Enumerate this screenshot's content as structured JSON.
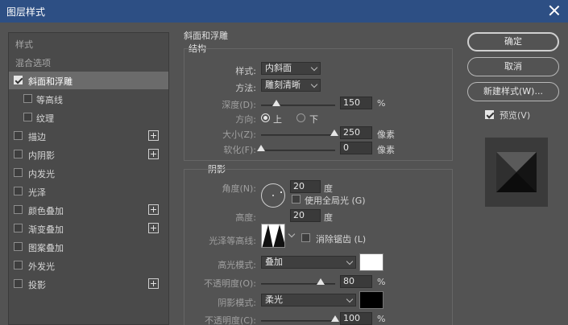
{
  "window": {
    "title": "图层样式"
  },
  "left_panel": {
    "items": [
      {
        "label": "样式",
        "checkbox": false,
        "checked": false,
        "selected": false,
        "plus": false,
        "indent": false,
        "dim": true
      },
      {
        "label": "混合选项",
        "checkbox": false,
        "checked": false,
        "selected": false,
        "plus": false,
        "indent": false,
        "dim": true
      },
      {
        "label": "斜面和浮雕",
        "checkbox": true,
        "checked": true,
        "selected": true,
        "plus": false,
        "indent": false,
        "dim": false
      },
      {
        "label": "等高线",
        "checkbox": true,
        "checked": false,
        "selected": false,
        "plus": false,
        "indent": true,
        "dim": false
      },
      {
        "label": "纹理",
        "checkbox": true,
        "checked": false,
        "selected": false,
        "plus": false,
        "indent": true,
        "dim": false
      },
      {
        "label": "描边",
        "checkbox": true,
        "checked": false,
        "selected": false,
        "plus": true,
        "indent": false,
        "dim": false
      },
      {
        "label": "内阴影",
        "checkbox": true,
        "checked": false,
        "selected": false,
        "plus": true,
        "indent": false,
        "dim": false
      },
      {
        "label": "内发光",
        "checkbox": true,
        "checked": false,
        "selected": false,
        "plus": false,
        "indent": false,
        "dim": false
      },
      {
        "label": "光泽",
        "checkbox": true,
        "checked": false,
        "selected": false,
        "plus": false,
        "indent": false,
        "dim": false
      },
      {
        "label": "颜色叠加",
        "checkbox": true,
        "checked": false,
        "selected": false,
        "plus": true,
        "indent": false,
        "dim": false
      },
      {
        "label": "渐变叠加",
        "checkbox": true,
        "checked": false,
        "selected": false,
        "plus": true,
        "indent": false,
        "dim": false
      },
      {
        "label": "图案叠加",
        "checkbox": true,
        "checked": false,
        "selected": false,
        "plus": false,
        "indent": false,
        "dim": false
      },
      {
        "label": "外发光",
        "checkbox": true,
        "checked": false,
        "selected": false,
        "plus": false,
        "indent": false,
        "dim": false
      },
      {
        "label": "投影",
        "checkbox": true,
        "checked": false,
        "selected": false,
        "plus": true,
        "indent": false,
        "dim": false
      }
    ]
  },
  "bevel": {
    "section_title": "斜面和浮雕",
    "structure_title": "结构",
    "style_label": "样式:",
    "style_value": "内斜面",
    "technique_label": "方法:",
    "technique_value": "雕刻清晰",
    "depth_label": "深度(D):",
    "depth_value": "150",
    "depth_unit": "%",
    "direction_label": "方向:",
    "direction_up": "上",
    "direction_down": "下",
    "size_label": "大小(Z):",
    "size_value": "250",
    "size_unit": "像素",
    "soften_label": "软化(F):",
    "soften_value": "0",
    "soften_unit": "像素"
  },
  "shading": {
    "section_title": "阴影",
    "angle_label": "角度(N):",
    "angle_value": "20",
    "angle_unit": "度",
    "global_light_label": "使用全局光 (G)",
    "altitude_label": "高度:",
    "altitude_value": "20",
    "altitude_unit": "度",
    "gloss_contour_label": "光泽等高线:",
    "antialias_label": "消除锯齿 (L)",
    "highlight_mode_label": "高光模式:",
    "highlight_mode_value": "叠加",
    "highlight_color": "#ffffff",
    "highlight_opacity_label": "不透明度(O):",
    "highlight_opacity_value": "80",
    "highlight_opacity_unit": "%",
    "shadow_mode_label": "阴影模式:",
    "shadow_mode_value": "柔光",
    "shadow_color": "#000000",
    "shadow_opacity_label": "不透明度(C):",
    "shadow_opacity_value": "100",
    "shadow_opacity_unit": "%"
  },
  "actions": {
    "ok_label": "确定",
    "cancel_label": "取消",
    "new_style_label": "新建样式(W)...",
    "preview_label": "预览(V)"
  }
}
